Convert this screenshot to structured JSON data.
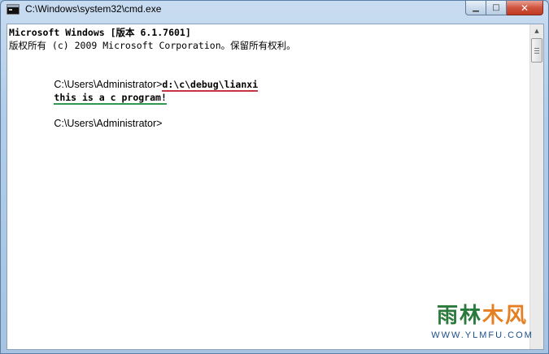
{
  "window": {
    "title": "C:\\Windows\\system32\\cmd.exe",
    "minimize_label": "▁",
    "maximize_label": "□",
    "close_label": "✕"
  },
  "console": {
    "line1": "Microsoft Windows [版本 6.1.7601]",
    "line2": "版权所有 (c) 2009 Microsoft Corporation。保留所有权利。",
    "prompt1": "C:\\Users\\Administrator>",
    "command1": "d:\\c\\debug\\lianxi",
    "output1": "this is a c program!",
    "prompt2": "C:\\Users\\Administrator>"
  },
  "watermark": {
    "logo_part1": "雨林",
    "logo_part2": "木风",
    "url": "WWW.YLMFU.COM"
  },
  "colors": {
    "underline_command": "#c8333f",
    "underline_output": "#2f9a4d",
    "close_button": "#c03a22"
  }
}
